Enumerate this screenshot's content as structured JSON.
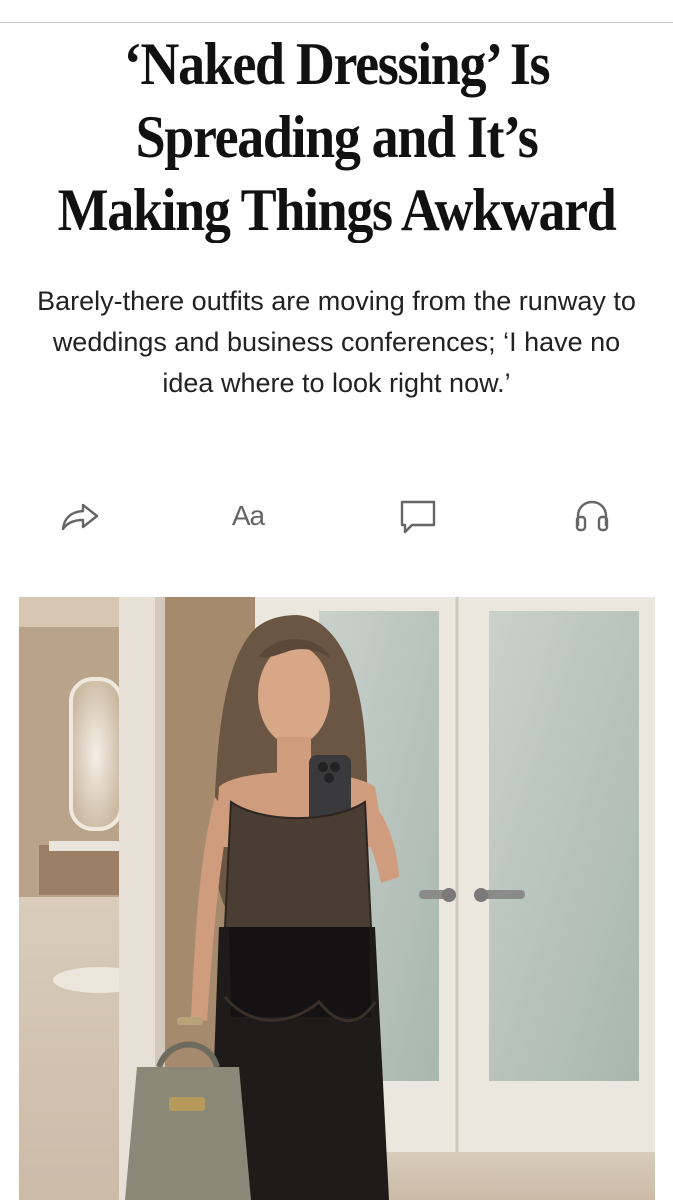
{
  "article": {
    "headline": "‘Naked Dressing’ Is Spreading and It’s Making Things Awkward",
    "dek": "Barely-there outfits are moving from the runway to weddings and business conferences; ‘I have no idea where to look right now.’"
  },
  "toolbar": {
    "share_icon": "share-arrow-icon",
    "text_size_label": "Aa",
    "comment_icon": "comment-bubble-icon",
    "listen_icon": "headphones-icon"
  },
  "colors": {
    "text": "#111111",
    "dek_text": "#222222",
    "icon": "#666666",
    "divider": "#c8c8c8"
  }
}
